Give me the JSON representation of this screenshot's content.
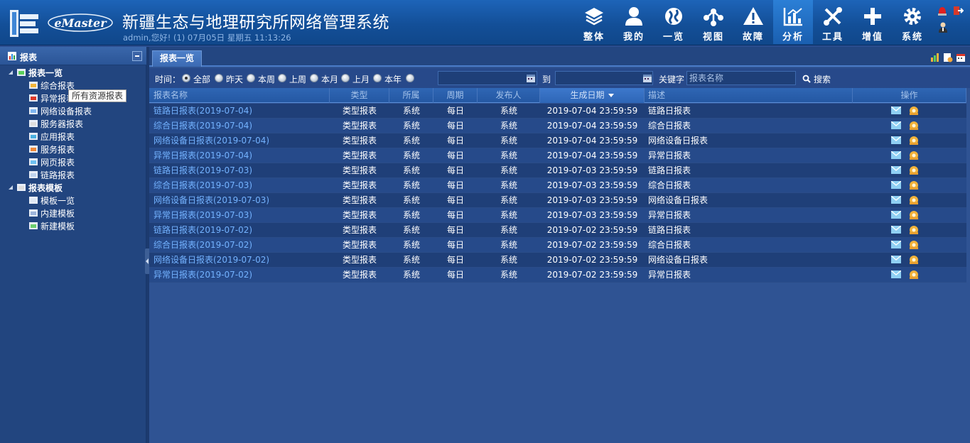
{
  "header": {
    "brand": "eMaster",
    "title": "新疆生态与地理研究所网络管理系统",
    "user_line": "admin,您好! (1) 07月05日 星期五 11:13:26",
    "nav": [
      {
        "label": "整体",
        "icon": "layers-icon"
      },
      {
        "label": "我的",
        "icon": "user-icon"
      },
      {
        "label": "一览",
        "icon": "globe-icon"
      },
      {
        "label": "视图",
        "icon": "topology-icon"
      },
      {
        "label": "故障",
        "icon": "warning-icon"
      },
      {
        "label": "分析",
        "icon": "chart-icon",
        "active": true
      },
      {
        "label": "工具",
        "icon": "tools-icon"
      },
      {
        "label": "增值",
        "icon": "plus-icon"
      },
      {
        "label": "系统",
        "icon": "gear-icon"
      }
    ]
  },
  "sidebar": {
    "title": "报表",
    "tree": [
      {
        "label": "报表一览",
        "group": true,
        "icon": "report-chart-icon"
      },
      {
        "label": "综合报表",
        "icon": "summary-report-icon"
      },
      {
        "label": "异常报表",
        "icon": "abnormal-report-icon"
      },
      {
        "label": "网络设备报表",
        "icon": "network-device-icon"
      },
      {
        "label": "服务器报表",
        "icon": "server-icon"
      },
      {
        "label": "应用报表",
        "icon": "application-icon"
      },
      {
        "label": "服务报表",
        "icon": "service-icon"
      },
      {
        "label": "网页报表",
        "icon": "webpage-icon"
      },
      {
        "label": "链路报表",
        "icon": "link-icon"
      },
      {
        "label": "报表模板",
        "group": true,
        "icon": "template-icon"
      },
      {
        "label": "模板一览",
        "icon": "template-list-icon"
      },
      {
        "label": "内建模板",
        "icon": "builtin-template-icon"
      },
      {
        "label": "新建模板",
        "icon": "new-template-icon"
      }
    ],
    "tooltip": "所有资源报表"
  },
  "main": {
    "tab": "报表一览",
    "filter": {
      "time_label": "时间：",
      "options": [
        "全部",
        "昨天",
        "本周",
        "上周",
        "本月",
        "上月",
        "本年"
      ],
      "selected": "全部",
      "to_label": "到",
      "keyword_label": "关键字",
      "keyword_placeholder": "报表名称",
      "search_label": "搜索"
    },
    "table": {
      "columns": [
        "报表名称",
        "类型",
        "所属",
        "周期",
        "发布人",
        "生成日期",
        "描述",
        "操作"
      ],
      "sorted_column": "生成日期",
      "rows": [
        [
          "链路日报表(2019-07-04)",
          "类型报表",
          "系统",
          "每日",
          "系统",
          "2019-07-04 23:59:59",
          "链路日报表"
        ],
        [
          "综合日报表(2019-07-04)",
          "类型报表",
          "系统",
          "每日",
          "系统",
          "2019-07-04 23:59:59",
          "综合日报表"
        ],
        [
          "网络设备日报表(2019-07-04)",
          "类型报表",
          "系统",
          "每日",
          "系统",
          "2019-07-04 23:59:59",
          "网络设备日报表"
        ],
        [
          "异常日报表(2019-07-04)",
          "类型报表",
          "系统",
          "每日",
          "系统",
          "2019-07-04 23:59:59",
          "异常日报表"
        ],
        [
          "链路日报表(2019-07-03)",
          "类型报表",
          "系统",
          "每日",
          "系统",
          "2019-07-03 23:59:59",
          "链路日报表"
        ],
        [
          "综合日报表(2019-07-03)",
          "类型报表",
          "系统",
          "每日",
          "系统",
          "2019-07-03 23:59:59",
          "综合日报表"
        ],
        [
          "网络设备日报表(2019-07-03)",
          "类型报表",
          "系统",
          "每日",
          "系统",
          "2019-07-03 23:59:59",
          "网络设备日报表"
        ],
        [
          "异常日报表(2019-07-03)",
          "类型报表",
          "系统",
          "每日",
          "系统",
          "2019-07-03 23:59:59",
          "异常日报表"
        ],
        [
          "链路日报表(2019-07-02)",
          "类型报表",
          "系统",
          "每日",
          "系统",
          "2019-07-02 23:59:59",
          "链路日报表"
        ],
        [
          "综合日报表(2019-07-02)",
          "类型报表",
          "系统",
          "每日",
          "系统",
          "2019-07-02 23:59:59",
          "综合日报表"
        ],
        [
          "网络设备日报表(2019-07-02)",
          "类型报表",
          "系统",
          "每日",
          "系统",
          "2019-07-02 23:59:59",
          "网络设备日报表"
        ],
        [
          "异常日报表(2019-07-02)",
          "类型报表",
          "系统",
          "每日",
          "系统",
          "2019-07-02 23:59:59",
          "异常日报表"
        ]
      ]
    }
  },
  "colors": {
    "header_bg": "#1d64b8",
    "nav_active": "#2b7fd6",
    "sidebar_bg": "#22457f",
    "main_bg": "#2f5393",
    "link": "#73b2ff",
    "row_odd": "#1f3f78",
    "row_even": "#264a8a"
  }
}
